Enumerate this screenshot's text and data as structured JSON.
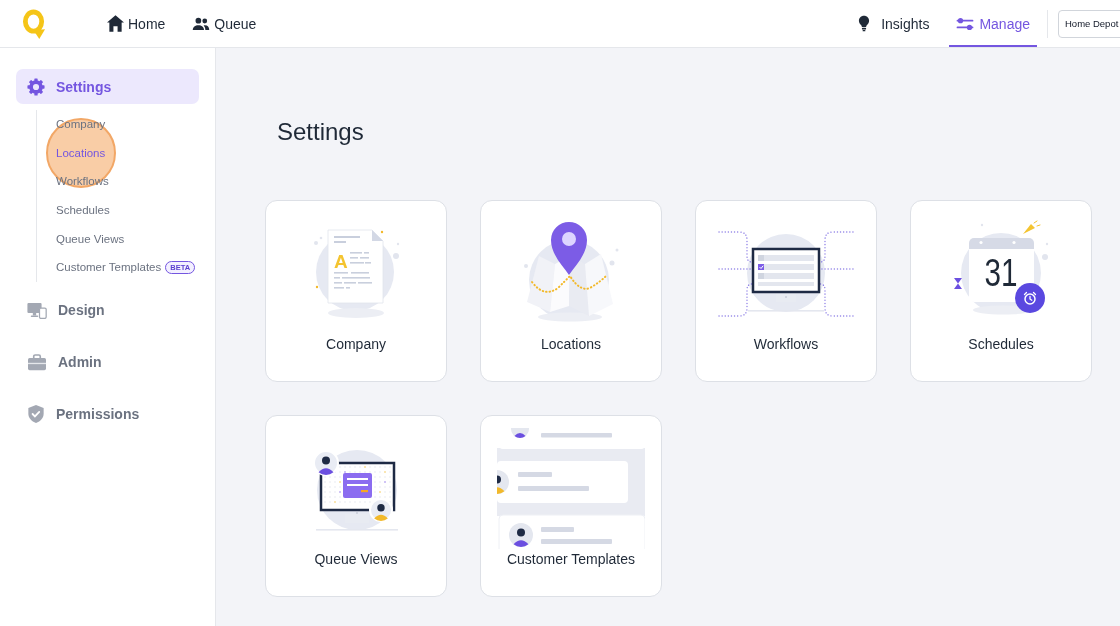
{
  "topbar": {
    "nav": [
      {
        "label": "Home",
        "selected": false
      },
      {
        "label": "Queue",
        "selected": false
      }
    ],
    "right_nav": [
      {
        "label": "Insights",
        "selected": false
      },
      {
        "label": "Manage",
        "selected": true
      }
    ],
    "org_select": {
      "value": "Home Depot"
    }
  },
  "sidebar": {
    "sections": [
      {
        "label": "Settings",
        "selected": true,
        "children": [
          {
            "label": "Company",
            "selected": false,
            "clicked": false
          },
          {
            "label": "Locations",
            "selected": true,
            "clicked": true
          },
          {
            "label": "Workflows",
            "selected": false,
            "clicked": false
          },
          {
            "label": "Schedules",
            "selected": false,
            "clicked": false
          },
          {
            "label": "Queue Views",
            "selected": false,
            "clicked": false
          },
          {
            "label": "Customer Templates",
            "selected": false,
            "clicked": false,
            "badge": "BETA"
          }
        ]
      },
      {
        "label": "Design",
        "selected": false
      },
      {
        "label": "Admin",
        "selected": false
      },
      {
        "label": "Permissions",
        "selected": false
      }
    ]
  },
  "main": {
    "title": "Settings",
    "cards": [
      {
        "label": "Company",
        "illustration_text": "A"
      },
      {
        "label": "Locations"
      },
      {
        "label": "Workflows"
      },
      {
        "label": "Schedules",
        "illustration_text": "31"
      },
      {
        "label": "Queue Views"
      },
      {
        "label": "Customer Templates"
      }
    ]
  }
}
